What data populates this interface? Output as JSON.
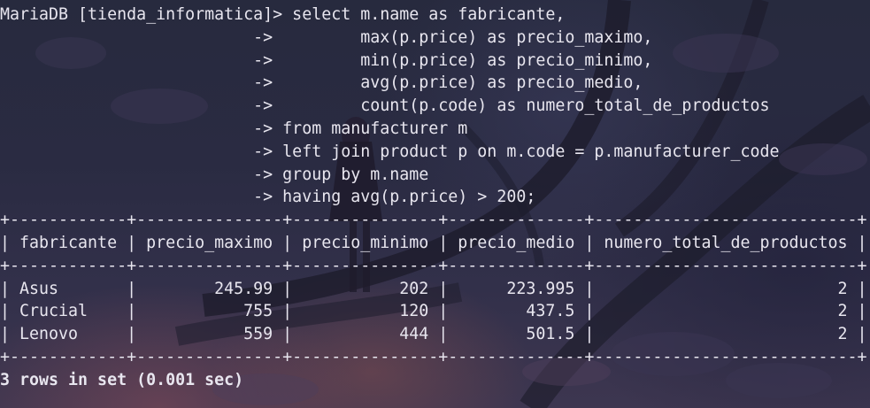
{
  "terminal": {
    "prompt": "MariaDB [tienda_informatica]>",
    "continuation_prompt": "->",
    "query_lines": [
      "select m.name as fabricante,",
      "        max(p.price) as precio_maximo,",
      "        min(p.price) as precio_minimo,",
      "        avg(p.price) as precio_medio,",
      "        count(p.code) as numero_total_de_productos",
      "from manufacturer m",
      "left join product p on m.code = p.manufacturer_code",
      "group by m.name",
      "having avg(p.price) > 200;"
    ],
    "table": {
      "columns": [
        "fabricante",
        "precio_maximo",
        "precio_minimo",
        "precio_medio",
        "numero_total_de_productos"
      ],
      "rows": [
        [
          "Asus",
          "245.99",
          "202",
          "223.995",
          "2"
        ],
        [
          "Crucial",
          "755",
          "120",
          "437.5",
          "2"
        ],
        [
          "Lenovo",
          "559",
          "444",
          "501.5",
          "2"
        ]
      ]
    },
    "result_summary": "3 rows in set (0.001 sec)"
  }
}
